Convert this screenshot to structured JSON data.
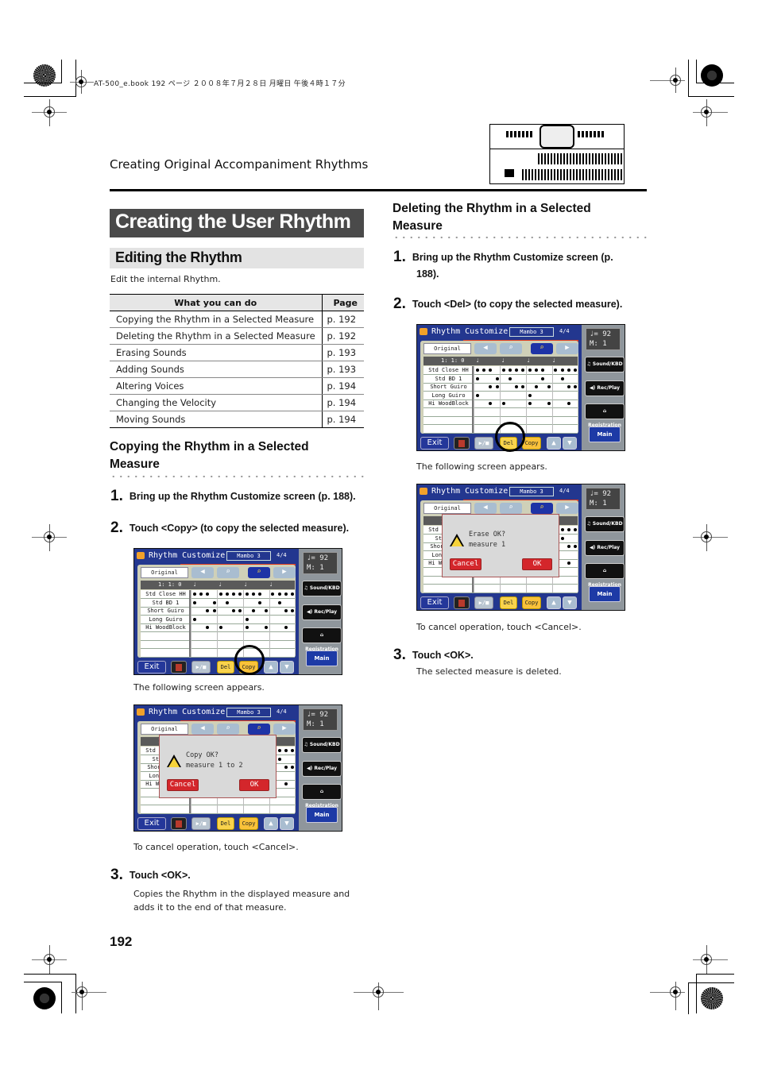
{
  "print_meta": "AT-500_e.book  192 ページ  ２００８年７月２８日  月曜日  午後４時１７分",
  "header": {
    "section_title": "Creating Original Accompaniment Rhythms",
    "illustration": "organ-panel-illustration"
  },
  "h1": "Creating the User Rhythm",
  "h2": "Editing the Rhythm",
  "intro": "Edit the internal Rhythm.",
  "feature_table": {
    "headers": [
      "What you can do",
      "Page"
    ],
    "rows": [
      [
        "Copying the Rhythm in a Selected Measure",
        "p. 192"
      ],
      [
        "Deleting the Rhythm in a Selected Measure",
        "p. 192"
      ],
      [
        "Erasing Sounds",
        "p. 193"
      ],
      [
        "Adding Sounds",
        "p. 193"
      ],
      [
        "Altering Voices",
        "p. 194"
      ],
      [
        "Changing the Velocity",
        "p. 194"
      ],
      [
        "Moving Sounds",
        "p. 194"
      ]
    ]
  },
  "copy_section": {
    "title_line1": "Copying the Rhythm in a Selected",
    "title_line2": "Measure",
    "steps": [
      {
        "num": "1.",
        "text": "Bring up the Rhythm Customize screen (p. 188)."
      },
      {
        "num": "2.",
        "text": "Touch <Copy> (to copy the selected measure)."
      },
      {
        "num": "3.",
        "text": "Touch <OK>."
      }
    ],
    "after_screen1": "The following screen appears.",
    "after_screen2": "To cancel operation, touch <Cancel>.",
    "step3_desc": "Copies the Rhythm in the displayed measure and adds it to the end of that measure.",
    "dialog": {
      "line1": "Copy OK?",
      "line2": "measure 1 to 2",
      "cancel": "Cancel",
      "ok": "OK"
    }
  },
  "delete_section": {
    "title_line1": "Deleting the Rhythm in a Selected",
    "title_line2": "Measure",
    "steps": [
      {
        "num": "1.",
        "text": "Bring up the Rhythm Customize screen (p.",
        "text2": "188)."
      },
      {
        "num": "2.",
        "text": "Touch <Del> (to copy the selected measure)."
      },
      {
        "num": "3.",
        "text": "Touch <OK>."
      }
    ],
    "after_screen1": "The following screen appears.",
    "after_screen2": "To cancel operation, touch <Cancel>.",
    "step3_desc": "The selected measure is deleted.",
    "dialog": {
      "line1": "Erase OK?",
      "line2": "measure 1",
      "cancel": "Cancel",
      "ok": "OK"
    }
  },
  "screen": {
    "title": "Rhythm Customize",
    "style_name": "Mambo 3",
    "time_signature": "4/4",
    "original_label": "Original",
    "position": "1: 1:  0",
    "tempo": "♩= 92",
    "measure": "M:   1",
    "instruments": [
      "Std Close HH",
      "Std BD 1",
      "Short Guiro",
      "Long Guiro",
      "Hi WoodBlock"
    ],
    "right_buttons": [
      "Sound/KBD",
      "Rec/Play",
      "Registration"
    ],
    "main_label": "Main",
    "exit_label": "Exit",
    "play_label": "▶/■",
    "del_label": "Del",
    "copy_label": "Copy",
    "icons": {
      "left": "◀",
      "right": "▶",
      "zoom_out": "⌕",
      "zoom_in": "⌕",
      "up": "▲",
      "down": "▼"
    },
    "beat_marks": [
      "♩",
      "♩",
      "♩",
      "♩"
    ]
  },
  "page_number": "192"
}
